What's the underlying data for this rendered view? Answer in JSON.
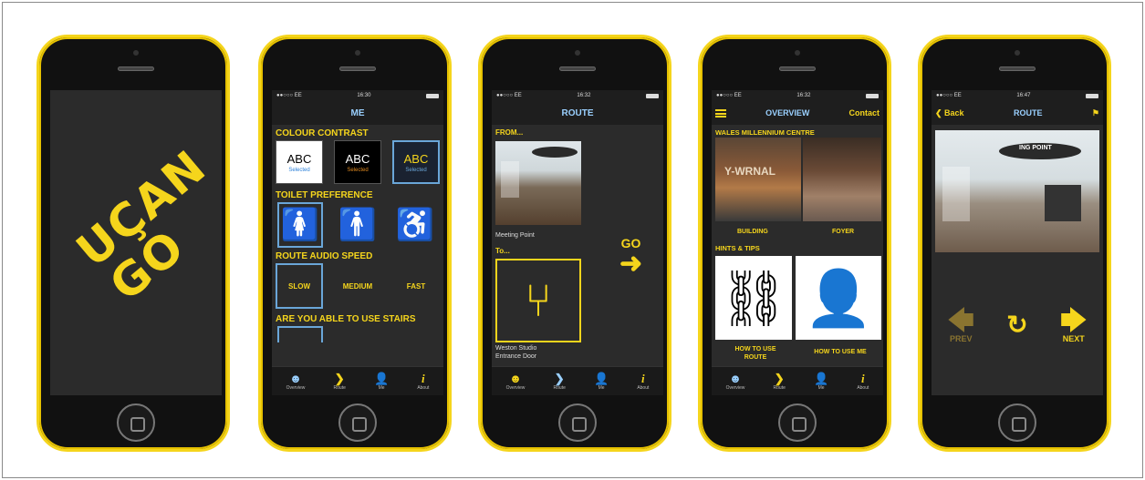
{
  "phone1": {
    "logo_line1": "UÇAN",
    "logo_line2": "GO"
  },
  "phone2": {
    "status": {
      "carrier": "●●○○○ EE ",
      "time": "16:30"
    },
    "title": "ME",
    "colour_contrast": {
      "heading": "COLOUR CONTRAST",
      "options": [
        {
          "text": "ABC",
          "state": "Selected"
        },
        {
          "text": "ABC",
          "state": "Selected"
        },
        {
          "text": "ABC",
          "state": "Selected"
        }
      ]
    },
    "toilet": {
      "heading": "TOILET PREFERENCE"
    },
    "audio": {
      "heading": "ROUTE AUDIO SPEED",
      "options": [
        "SLOW",
        "MEDIUM",
        "FAST"
      ]
    },
    "stairs": {
      "heading": "ARE YOU ABLE TO USE STAIRS"
    }
  },
  "phone3": {
    "status": {
      "carrier": "●●○○○ EE ",
      "time": "16:32"
    },
    "title": "ROUTE",
    "from_heading": "FROM...",
    "from_label": "Meeting Point",
    "to_heading": "To...",
    "to_label_line1": "Weston Studio",
    "to_label_line2": "Entrance Door",
    "go_label": "GO"
  },
  "phone4": {
    "status": {
      "carrier": "●●○○○ EE ",
      "time": "16:32"
    },
    "title": "OVERVIEW",
    "contact": "Contact",
    "venue_heading": "WALES MILLENNIUM CENTRE",
    "photo_text": "Y-WRNAL",
    "building_label": "BUILDING",
    "foyer_label": "FOYER",
    "hints_heading": "HINTS & TIPS",
    "hint1_line1": "HOW TO USE",
    "hint1_line2": "ROUTE",
    "hint2": "HOW TO USE ME"
  },
  "phone5": {
    "status": {
      "carrier": "●●○○○ EE ",
      "time": "16:47"
    },
    "back": "Back",
    "title": "ROUTE",
    "sign_text": "ING POINT",
    "prev": "PREV",
    "next": "NEXT"
  },
  "tabbar": {
    "overview": "Overview",
    "route": "Route",
    "me": "Me",
    "about": "About"
  },
  "colors": {
    "accent": "#f5d51c",
    "title_blue": "#9ad0ff",
    "screen_bg": "#2b2b2b",
    "phone_shell": "#f5d51c"
  }
}
